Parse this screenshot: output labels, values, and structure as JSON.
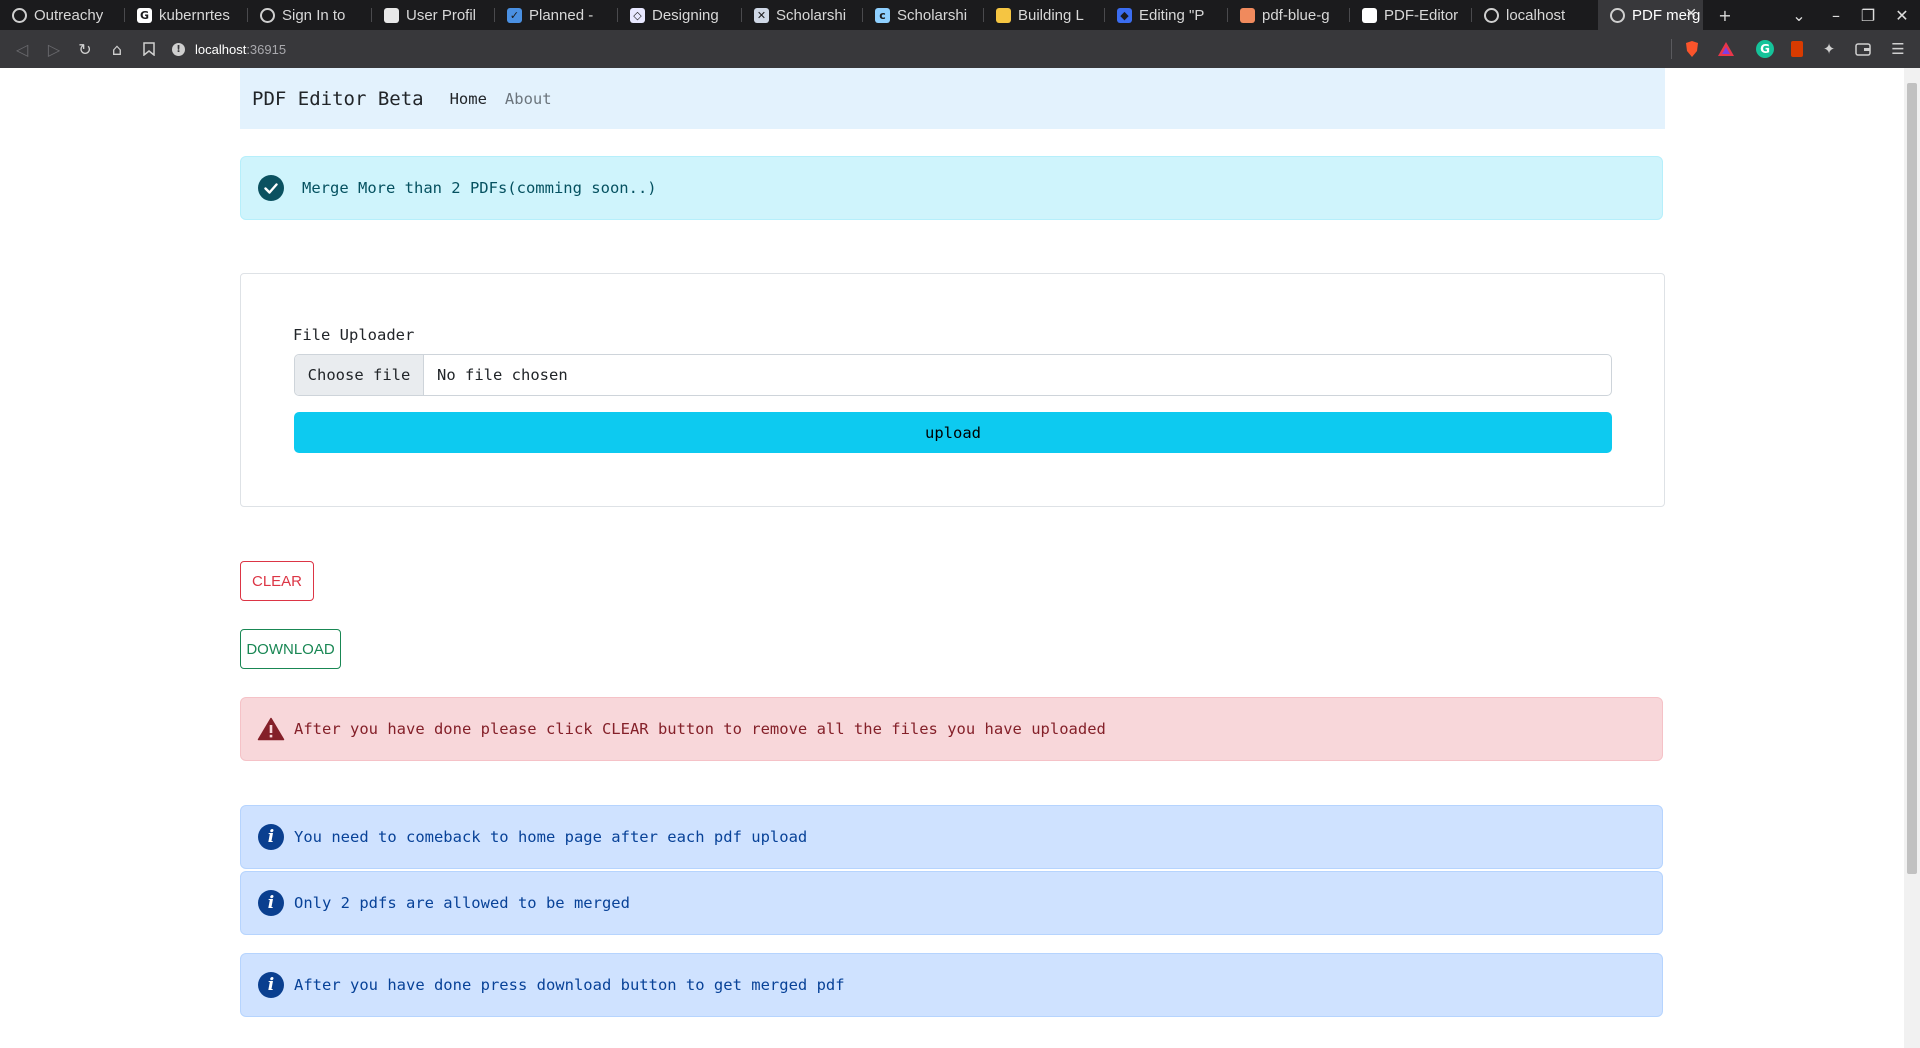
{
  "browser": {
    "tabs": [
      {
        "title": "Outreachy",
        "icon": "globe-icon",
        "fav_color": "#cfcfcf",
        "glyph": ""
      },
      {
        "title": "kubernrtes",
        "icon": "google-icon",
        "fav_color": "#ffffff",
        "glyph": "G"
      },
      {
        "title": "Sign In to",
        "icon": "globe-icon",
        "fav_color": "#cfcfcf",
        "glyph": ""
      },
      {
        "title": "User Profil",
        "icon": "profile-icon",
        "fav_color": "#e8e8e8",
        "glyph": ""
      },
      {
        "title": "Planned -",
        "icon": "check-icon",
        "fav_color": "#4a90e2",
        "glyph": "✓"
      },
      {
        "title": "Designing",
        "icon": "design-icon",
        "fav_color": "#e8e8ff",
        "glyph": "◇"
      },
      {
        "title": "Scholarshi",
        "icon": "scholarship-icon",
        "fav_color": "#cfd8e6",
        "glyph": "✕"
      },
      {
        "title": "Scholarshi",
        "icon": "scholarship-icon",
        "fav_color": "#8fd0ff",
        "glyph": "c"
      },
      {
        "title": "Building L",
        "icon": "box-icon",
        "fav_color": "#f5c542",
        "glyph": ""
      },
      {
        "title": "Editing \"P",
        "icon": "diamond-icon",
        "fav_color": "#3b6df0",
        "glyph": "◆"
      },
      {
        "title": "pdf-blue-g",
        "icon": "record-icon",
        "fav_color": "#f08a5d",
        "glyph": ""
      },
      {
        "title": "PDF-Editor",
        "icon": "github-icon",
        "fav_color": "#ffffff",
        "glyph": ""
      },
      {
        "title": "localhost",
        "icon": "globe-icon",
        "fav_color": "#cfcfcf",
        "glyph": ""
      },
      {
        "title": "PDF merg",
        "icon": "globe-icon",
        "fav_color": "#cfcfcf",
        "glyph": "",
        "active": true
      }
    ],
    "url_host": "localhost",
    "url_port": ":36915"
  },
  "navbar": {
    "brand": "PDF Editor Beta",
    "home": "Home",
    "about": "About"
  },
  "alert_success": {
    "text": "Merge More than 2 PDFs(comming soon..)",
    "icon": "check-circle-icon"
  },
  "uploader": {
    "label": "File Uploader",
    "choose_label": "Choose file",
    "status": "No file chosen",
    "upload_label": "upload"
  },
  "buttons": {
    "clear": "CLEAR",
    "download": "DOWNLOAD"
  },
  "alert_danger": {
    "text": "After you have done please click CLEAR button to remove all the files you have uploaded",
    "icon": "warning-triangle-icon"
  },
  "info_alerts": [
    {
      "text": "You need to comeback to home page after each pdf upload"
    },
    {
      "text": "Only 2 pdfs are allowed to be merged"
    },
    {
      "text": "After you have done press download button to get merged pdf"
    }
  ],
  "colors": {
    "navbar_bg": "#e3f2fd",
    "upload_btn": "#0dcaf0",
    "danger": "#dc3545",
    "success": "#198754"
  }
}
